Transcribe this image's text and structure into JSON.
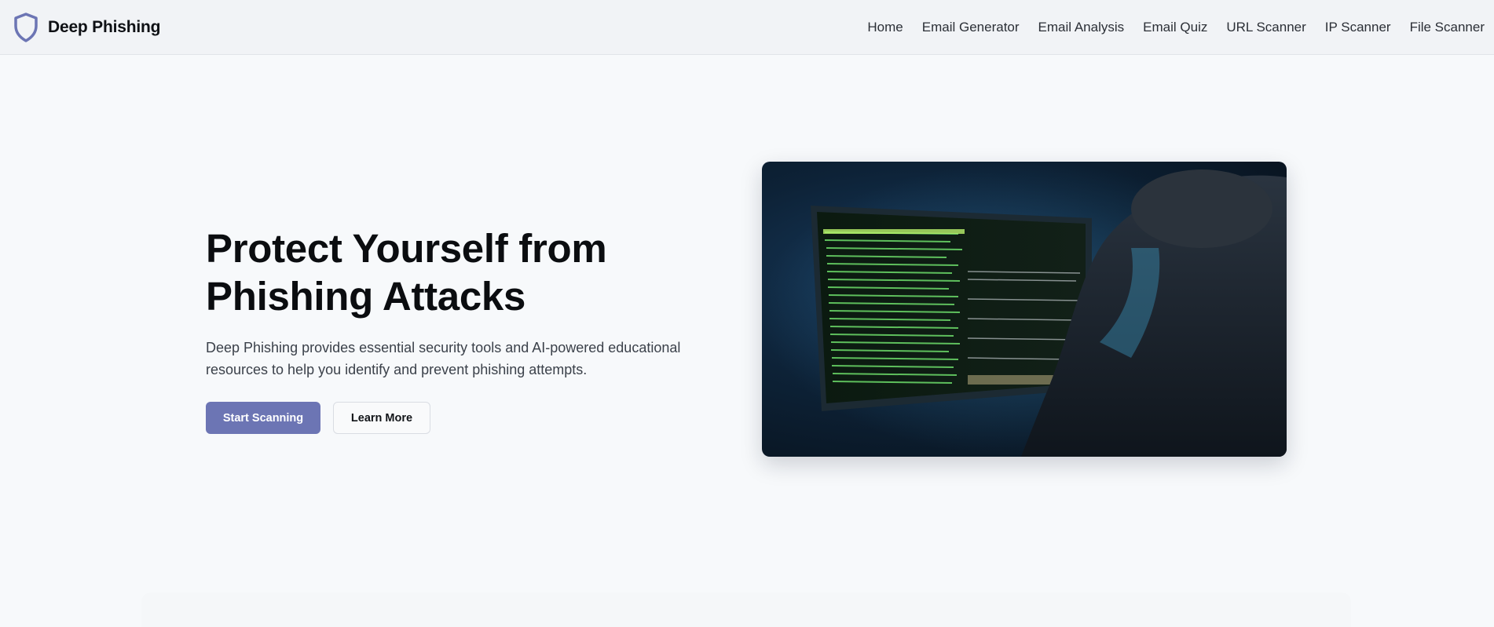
{
  "brand": {
    "name": "Deep Phishing",
    "accent": "#6c75b4"
  },
  "nav": {
    "links": [
      "Home",
      "Email Generator",
      "Email Analysis",
      "Email Quiz",
      "URL Scanner",
      "IP Scanner",
      "File Scanner"
    ]
  },
  "hero": {
    "title_line1": "Protect Yourself from",
    "title_line2": "Phishing Attacks",
    "description": "Deep Phishing provides essential security tools and AI-powered educational resources to help you identify and prevent phishing attempts.",
    "primary_button": "Start Scanning",
    "secondary_button": "Learn More"
  },
  "hero_image": {
    "icon": "hacker-at-monitor-photo"
  }
}
